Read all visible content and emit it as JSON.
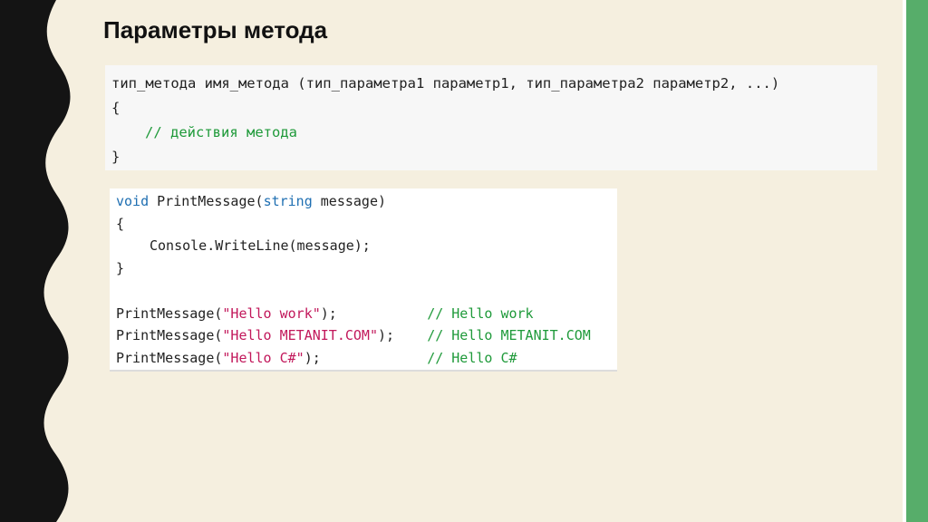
{
  "slide": {
    "title": "Параметры метода"
  },
  "syntax_block": {
    "line1": "тип_метода имя_метода (тип_параметра1 параметр1, тип_параметра2 параметр2, ...)",
    "open_brace": "{",
    "comment": "// действия метода",
    "close_brace": "}"
  },
  "example_block": {
    "decl_keyword": "void",
    "decl_name": " PrintMessage(",
    "decl_type": "string",
    "decl_rest": " message)",
    "open_brace": "{",
    "body": "Console.WriteLine(message);",
    "close_brace": "}",
    "calls": [
      {
        "prefix": "PrintMessage(",
        "arg": "\"Hello work\"",
        "suffix": ");           ",
        "comment": "// Hello work"
      },
      {
        "prefix": "PrintMessage(",
        "arg": "\"Hello METANIT.COM\"",
        "suffix": ");    ",
        "comment": "// Hello METANIT.COM"
      },
      {
        "prefix": "PrintMessage(",
        "arg": "\"Hello C#\"",
        "suffix": ");             ",
        "comment": "// Hello C#"
      }
    ]
  },
  "colors": {
    "background": "#f5efdf",
    "accent_stripe": "#57ad6a",
    "keyword": "#1f6fb2",
    "string": "#c2185b",
    "comment": "#1f9a3a"
  }
}
